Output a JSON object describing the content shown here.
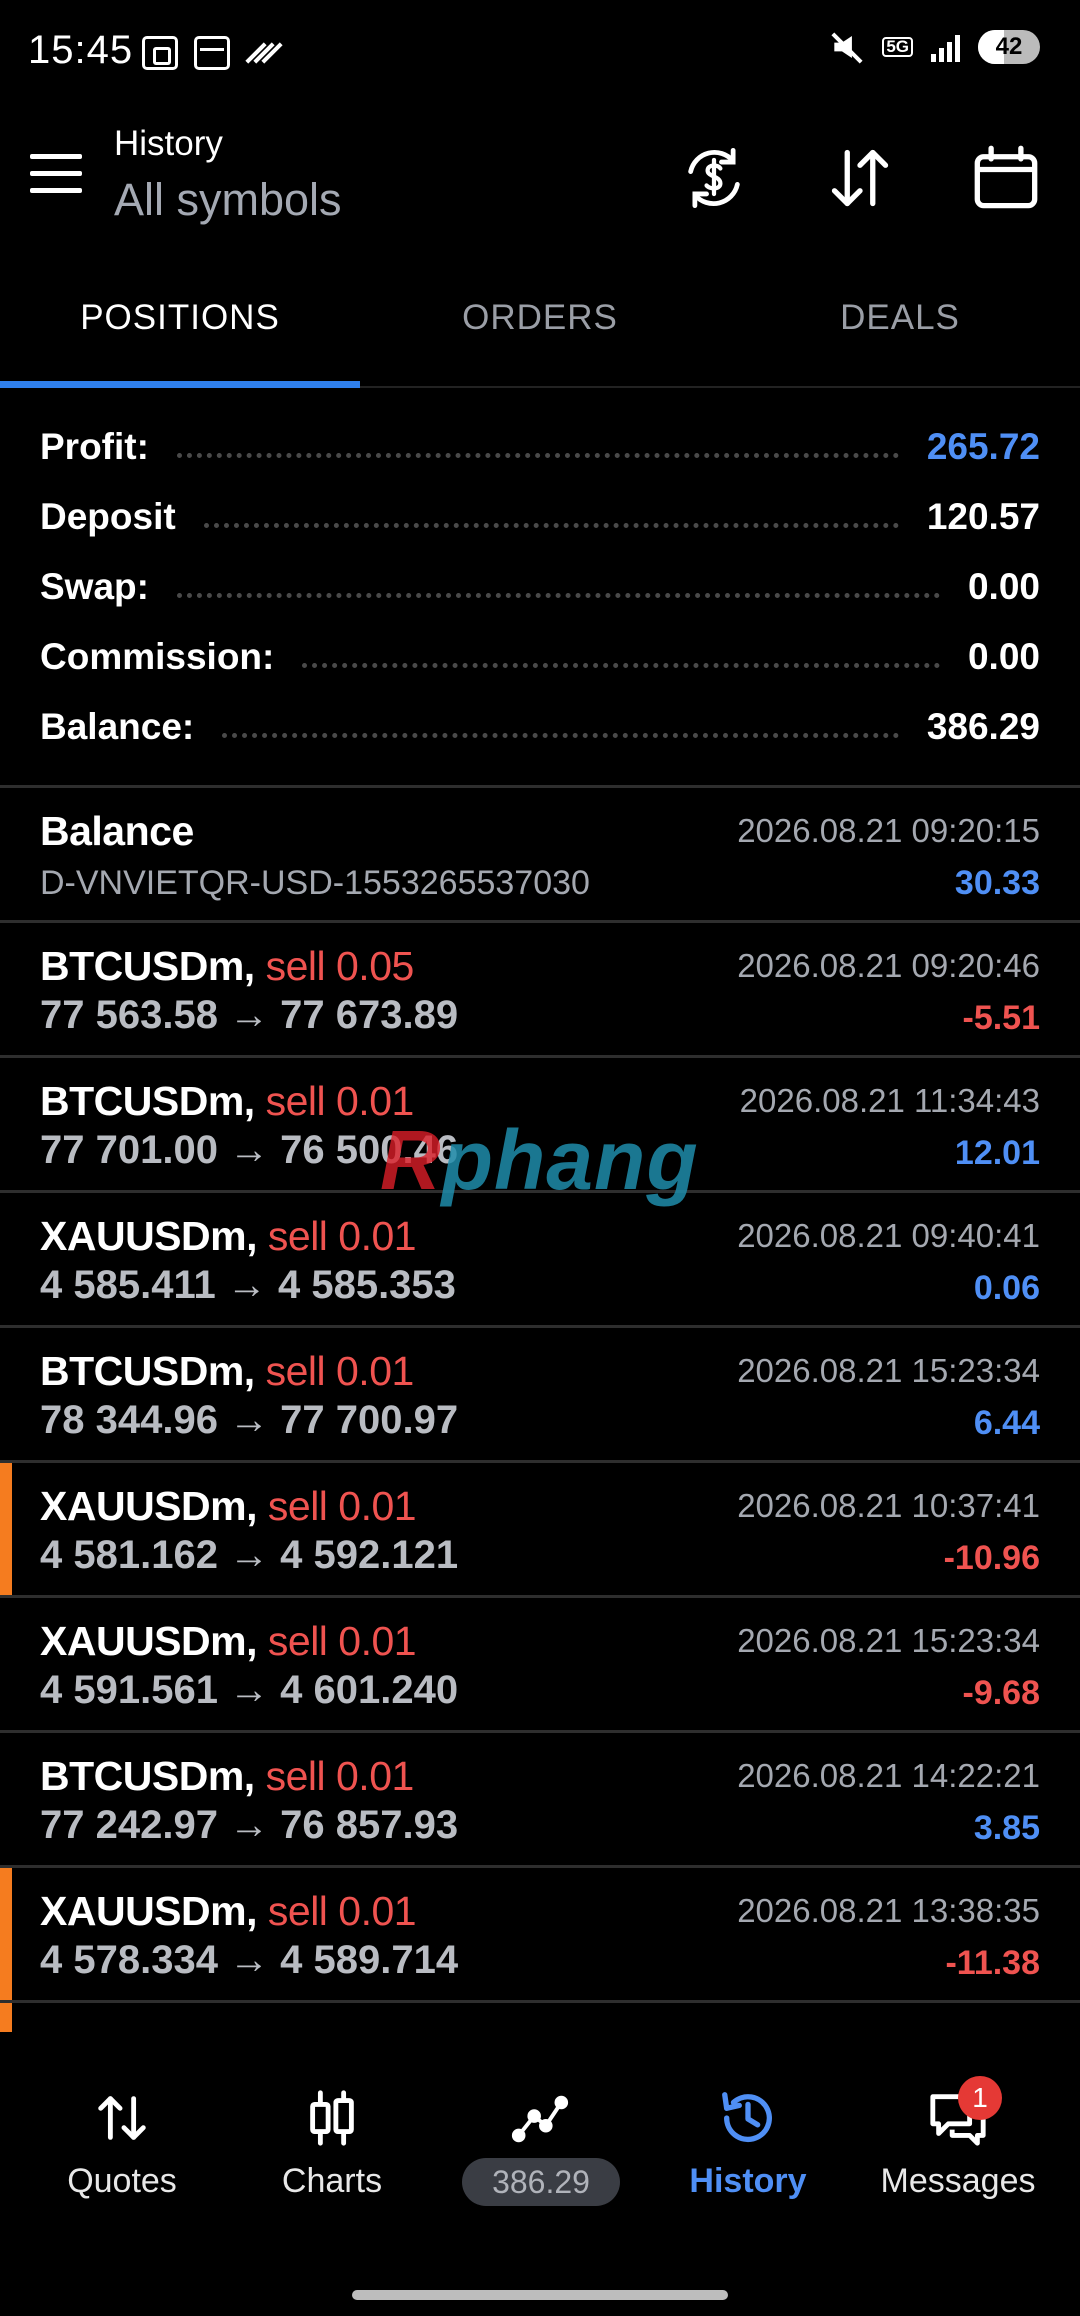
{
  "status_bar": {
    "time": "15:45",
    "battery": "42",
    "network": "5G"
  },
  "header": {
    "title": "History",
    "subtitle": "All symbols",
    "icons": [
      "currency-exchange-icon",
      "sort-icon",
      "calendar-icon"
    ]
  },
  "tabs": [
    {
      "label": "POSITIONS",
      "active": true
    },
    {
      "label": "ORDERS",
      "active": false
    },
    {
      "label": "DEALS",
      "active": false
    }
  ],
  "summary": {
    "profit": {
      "label": "Profit:",
      "value": "265.72"
    },
    "deposit": {
      "label": "Deposit",
      "value": "120.57"
    },
    "swap": {
      "label": "Swap:",
      "value": "0.00"
    },
    "commission": {
      "label": "Commission:",
      "value": "0.00"
    },
    "balance": {
      "label": "Balance:",
      "value": "386.29"
    }
  },
  "balance_entry": {
    "title": "Balance",
    "detail": "D-VNVIETQR-USD-1553265537030",
    "time": "2026.08.21 09:20:15",
    "amount": "30.33"
  },
  "positions": [
    {
      "symbol": "BTCUSDm,",
      "side": "sell 0.05",
      "prices": "77 563.58 → 77 673.89",
      "time": "2026.08.21 09:20:46",
      "pl": "-5.51",
      "marker": false
    },
    {
      "symbol": "BTCUSDm,",
      "side": "sell 0.01",
      "prices": "77 701.00 → 76 500.46",
      "time": "2026.08.21 11:34:43",
      "pl": "12.01",
      "marker": false
    },
    {
      "symbol": "XAUUSDm,",
      "side": "sell 0.01",
      "prices": "4 585.411 → 4 585.353",
      "time": "2026.08.21 09:40:41",
      "pl": "0.06",
      "marker": false
    },
    {
      "symbol": "BTCUSDm,",
      "side": "sell 0.01",
      "prices": "78 344.96 → 77 700.97",
      "time": "2026.08.21 15:23:34",
      "pl": "6.44",
      "marker": false
    },
    {
      "symbol": "XAUUSDm,",
      "side": "sell 0.01",
      "prices": "4 581.162 → 4 592.121",
      "time": "2026.08.21 10:37:41",
      "pl": "-10.96",
      "marker": true
    },
    {
      "symbol": "XAUUSDm,",
      "side": "sell 0.01",
      "prices": "4 591.561 → 4 601.240",
      "time": "2026.08.21 15:23:34",
      "pl": "-9.68",
      "marker": false
    },
    {
      "symbol": "BTCUSDm,",
      "side": "sell 0.01",
      "prices": "77 242.97 → 76 857.93",
      "time": "2026.08.21 14:22:21",
      "pl": "3.85",
      "marker": false
    },
    {
      "symbol": "XAUUSDm,",
      "side": "sell 0.01",
      "prices": "4 578.334 → 4 589.714",
      "time": "2026.08.21 13:38:35",
      "pl": "-11.38",
      "marker": true
    }
  ],
  "watermark": {
    "part1": "R",
    "part2": "phang"
  },
  "bottom_nav": {
    "quotes": "Quotes",
    "charts": "Charts",
    "equity": "386.29",
    "history": "History",
    "messages": "Messages",
    "messages_badge": "1"
  },
  "colors": {
    "accent": "#2f80ed",
    "profit_positive": "#4f8ff5",
    "profit_negative": "#ef5350",
    "sell": "#ef5350",
    "marker": "#f57c1f"
  }
}
